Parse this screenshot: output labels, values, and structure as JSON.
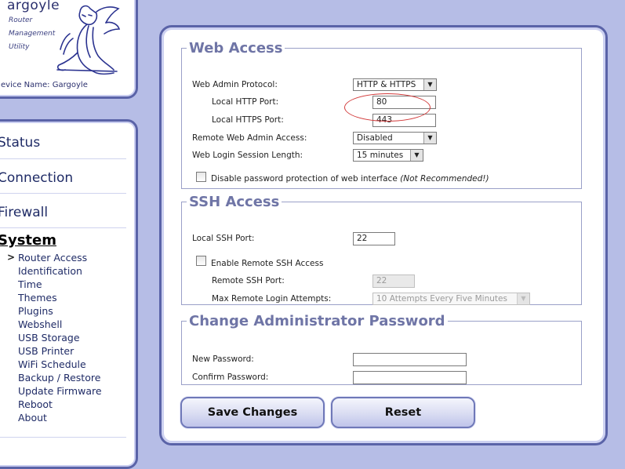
{
  "logo": {
    "title": "argoyle",
    "subtitle_lines": [
      "Router",
      "Management",
      "Utility"
    ],
    "device_name": "evice Name: Gargoyle"
  },
  "nav": {
    "main_items": [
      "Status",
      "Connection",
      "Firewall"
    ],
    "system_label": "System",
    "active_marker": ">",
    "sub_items": [
      "Router Access",
      "Identification",
      "Time",
      "Themes",
      "Plugins",
      "Webshell",
      "USB Storage",
      "USB Printer",
      "WiFi Schedule",
      "Backup / Restore",
      "Update Firmware",
      "Reboot",
      "About"
    ]
  },
  "web_access": {
    "legend": "Web Access",
    "protocol_label": "Web Admin Protocol:",
    "protocol_value": "HTTP & HTTPS",
    "http_port_label": "Local HTTP Port:",
    "http_port_value": "80",
    "https_port_label": "Local HTTPS Port:",
    "https_port_value": "443",
    "remote_label": "Remote Web Admin Access:",
    "remote_value": "Disabled",
    "session_label": "Web Login Session Length:",
    "session_value": "15 minutes",
    "disable_pw_label": "Disable password protection of web interface",
    "disable_pw_note": "(Not Recommended!)"
  },
  "ssh_access": {
    "legend": "SSH Access",
    "local_port_label": "Local SSH Port:",
    "local_port_value": "22",
    "enable_remote_label": "Enable Remote SSH Access",
    "remote_port_label": "Remote SSH Port:",
    "remote_port_value": "22",
    "max_attempts_label": "Max Remote Login Attempts:",
    "max_attempts_value": "10 Attempts Every Five Minutes"
  },
  "password": {
    "legend": "Change Administrator Password",
    "new_label": "New Password:",
    "confirm_label": "Confirm Password:"
  },
  "buttons": {
    "save": "Save Changes",
    "reset": "Reset"
  },
  "colors": {
    "background": "#b6bde6",
    "panel_border": "#5a63a8",
    "legend_text": "#6f75a6",
    "highlight_ellipse": "#d23a3a"
  }
}
